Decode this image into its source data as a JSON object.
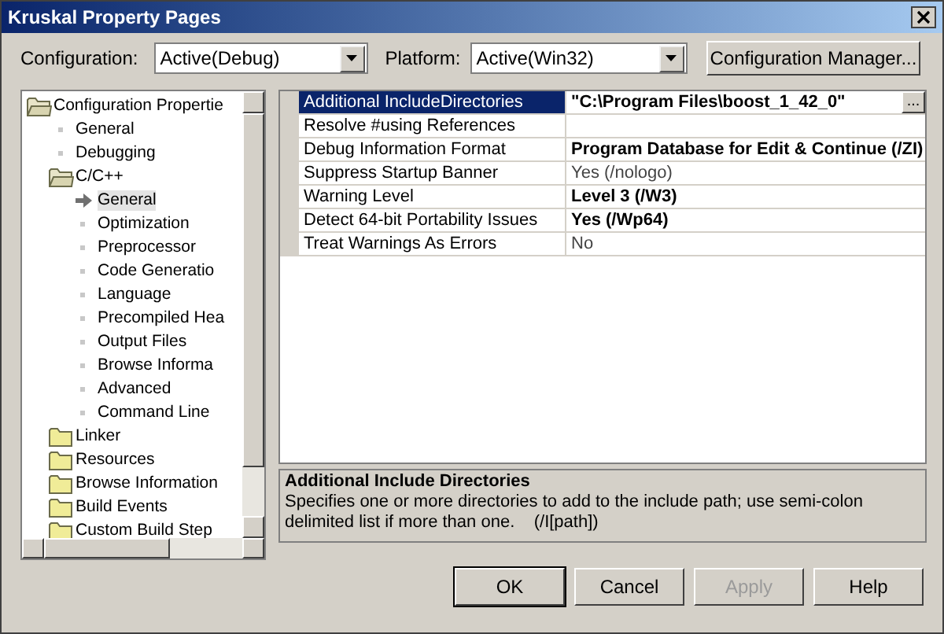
{
  "window": {
    "title": "Kruskal Property Pages"
  },
  "configuration": {
    "label": "Configuration:",
    "value": "Active(Debug)"
  },
  "platform": {
    "label": "Platform:",
    "value": "Active(Win32)"
  },
  "config_manager_button": "Configuration Manager...",
  "tree": [
    {
      "label": "Configuration Propertie",
      "kind": "folder",
      "expanded": true,
      "selected": false,
      "children": [
        {
          "label": "General",
          "kind": "leaf",
          "selected": false
        },
        {
          "label": "Debugging",
          "kind": "leaf",
          "selected": false
        },
        {
          "label": "C/C++",
          "kind": "folder",
          "expanded": true,
          "selected": false,
          "children": [
            {
              "label": "General",
              "kind": "leaf",
              "selected": true
            },
            {
              "label": "Optimization",
              "kind": "leaf",
              "selected": false
            },
            {
              "label": "Preprocessor",
              "kind": "leaf",
              "selected": false
            },
            {
              "label": "Code Generatio",
              "kind": "leaf",
              "selected": false
            },
            {
              "label": "Language",
              "kind": "leaf",
              "selected": false
            },
            {
              "label": "Precompiled Hea",
              "kind": "leaf",
              "selected": false
            },
            {
              "label": "Output Files",
              "kind": "leaf",
              "selected": false
            },
            {
              "label": "Browse Informa",
              "kind": "leaf",
              "selected": false
            },
            {
              "label": "Advanced",
              "kind": "leaf",
              "selected": false
            },
            {
              "label": "Command Line",
              "kind": "leaf",
              "selected": false
            }
          ]
        },
        {
          "label": "Linker",
          "kind": "folder",
          "expanded": false,
          "selected": false
        },
        {
          "label": "Resources",
          "kind": "folder",
          "expanded": false,
          "selected": false
        },
        {
          "label": "Browse Information",
          "kind": "folder",
          "expanded": false,
          "selected": false
        },
        {
          "label": "Build Events",
          "kind": "folder",
          "expanded": false,
          "selected": false
        },
        {
          "label": "Custom Build Step",
          "kind": "folder",
          "expanded": false,
          "selected": false
        }
      ]
    }
  ],
  "properties": [
    {
      "name": "Additional IncludeDirectories",
      "value": "\"C:\\Program Files\\boost_1_42_0\"",
      "bold": true,
      "selected": true,
      "browse": "..."
    },
    {
      "name": "Resolve #using References",
      "selected": false
    },
    {
      "name": "Debug Information Format",
      "value": "Program Database for Edit & Continue (/ZI)",
      "bold": true,
      "selected": false
    },
    {
      "name": "Suppress Startup Banner",
      "value": "Yes (/nologo)",
      "bold": false,
      "selected": false
    },
    {
      "name": "Warning Level",
      "value": "Level 3 (/W3)",
      "bold": true,
      "selected": false
    },
    {
      "name": "Detect 64-bit Portability Issues",
      "value": "Yes (/Wp64)",
      "bold": true,
      "selected": false
    },
    {
      "name": "Treat Warnings As Errors",
      "value": "No",
      "bold": false,
      "selected": false
    }
  ],
  "description": {
    "title": "Additional Include Directories",
    "text": "Specifies one or more directories to add to the include path; use semi-colon delimited list if more than one.    (/I[path])"
  },
  "buttons": [
    {
      "label": "OK",
      "disabled": false
    },
    {
      "label": "Cancel",
      "disabled": false
    },
    {
      "label": "Apply",
      "disabled": true
    },
    {
      "label": "Help",
      "disabled": false
    }
  ]
}
